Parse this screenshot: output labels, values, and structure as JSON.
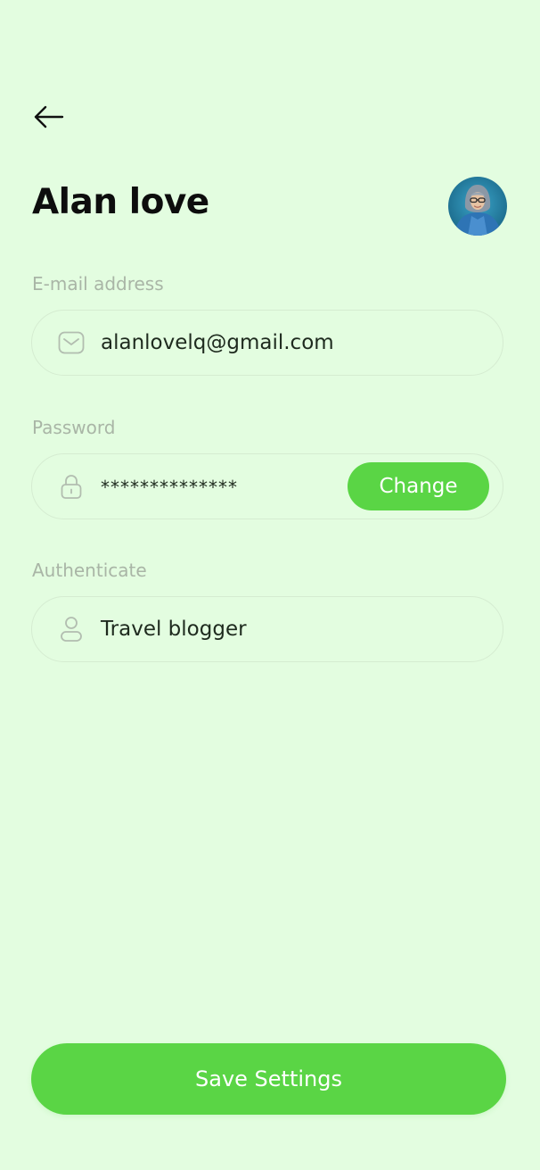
{
  "header": {
    "back_icon": "arrow-left-icon"
  },
  "profile": {
    "name": "Alan love",
    "avatar_icon": "avatar-photo"
  },
  "fields": {
    "email": {
      "label": "E-mail address",
      "value": "alanlovelq@gmail.com",
      "icon": "mail-icon"
    },
    "password": {
      "label": "Password",
      "value": "**************",
      "icon": "lock-icon",
      "action_label": "Change"
    },
    "authenticate": {
      "label": "Authenticate",
      "value": "Travel blogger",
      "icon": "user-icon"
    }
  },
  "footer": {
    "save_label": "Save Settings"
  },
  "colors": {
    "background": "#e3fde0",
    "accent": "#5ad545",
    "label": "#a9b5a6",
    "border": "#d5ecd1"
  }
}
